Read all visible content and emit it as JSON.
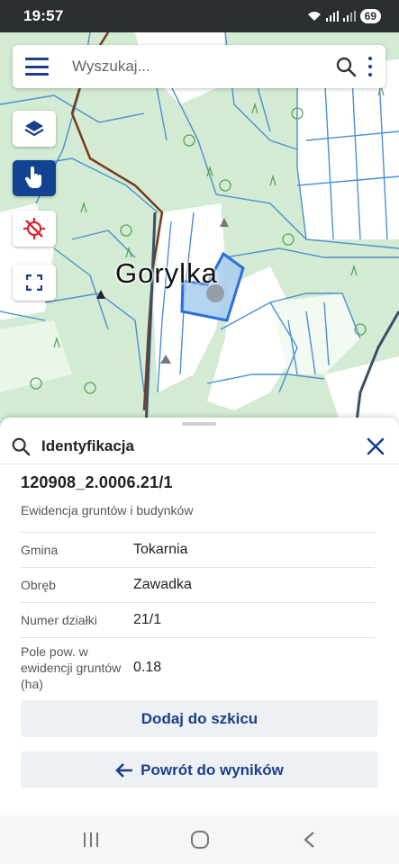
{
  "status_bar": {
    "time": "19:57",
    "battery": "69"
  },
  "search": {
    "placeholder": "Wyszukaj..."
  },
  "map": {
    "place_label": "Gorylka"
  },
  "panel": {
    "title": "Identyfikacja",
    "parcel_id": "120908_2.0006.21/1",
    "source": "Ewidencja gruntów i budynków",
    "attributes": [
      {
        "key": "Gmina",
        "value": "Tokarnia"
      },
      {
        "key": "Obręb",
        "value": "Zawadka"
      },
      {
        "key": "Numer działki",
        "value": "21/1"
      },
      {
        "key": "Pole pow. w ewidencji gruntów (ha)",
        "value": "0.18"
      }
    ],
    "add_to_sketch_label": "Dodaj do szkicu",
    "back_to_results_label": "Powrót do wyników"
  },
  "colors": {
    "accent": "#1a3f8a",
    "active_tool": "#124393",
    "parcel_outline": "#2a6fe0",
    "status_bar": "#2b2e33",
    "location_off": "#d9262c"
  }
}
